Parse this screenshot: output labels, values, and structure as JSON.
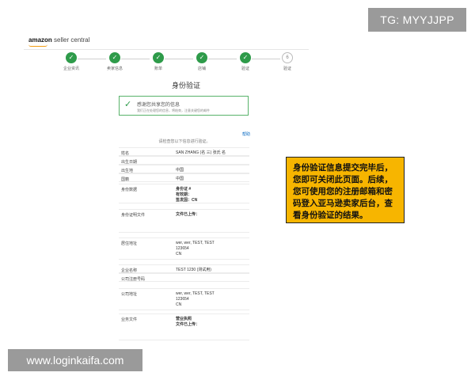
{
  "overlays": {
    "tg_label": "TG: MYYJJPP",
    "site_label": "www.loginkaifa.com"
  },
  "header": {
    "logo_brand": "amazon",
    "logo_product": "seller central"
  },
  "stepper": {
    "steps": [
      {
        "label": "企业资讯",
        "state": "done"
      },
      {
        "label": "卖家信息",
        "state": "done"
      },
      {
        "label": "账单",
        "state": "done"
      },
      {
        "label": "店铺",
        "state": "done"
      },
      {
        "label": "验证",
        "state": "done"
      },
      {
        "label": "验证",
        "state": "pending",
        "number": "6"
      }
    ],
    "done_symbol": "✓"
  },
  "page_title": "身份验证",
  "success": {
    "check_symbol": "✓",
    "title": "感谢您共享您的信息",
    "subtitle": "我们正在处理您的信息，将结束，注意关键您的邮件"
  },
  "help_link": "帮助",
  "review_note": "请检查您以下信息进行验证。",
  "rows": [
    {
      "key": "姓名",
      "value": "SAN ZHANG (名 三)  张氏 名"
    },
    {
      "key": "出生日期",
      "value": ""
    },
    {
      "key": "出生地",
      "value": "中国"
    },
    {
      "key": "国籍",
      "value": "中国"
    },
    {
      "key": "身份数据",
      "value": "身份证 #\n有效期：\n签发国：CN"
    },
    {
      "key": "身份证明文件",
      "value": "文件已上传："
    },
    {
      "key": "居住地址",
      "value": "wer, wer, TEST, TEST\n123654\nCN"
    },
    {
      "key": "企业名称",
      "value": "TEST 1230 (测试用)"
    },
    {
      "key": "公司注册号码",
      "value": ""
    },
    {
      "key": "公司地址",
      "value": "wer, wer, TEST, TEST\n123654\nCN"
    },
    {
      "key": "业务文件",
      "value": "营业执照\n文件已上传："
    }
  ],
  "callout_text": "身份验证信息提交完毕后，您即可关闭此页面。后续，您可使用您的注册邮箱和密码登入亚马逊卖家后台，查看身份验证的结果。"
}
